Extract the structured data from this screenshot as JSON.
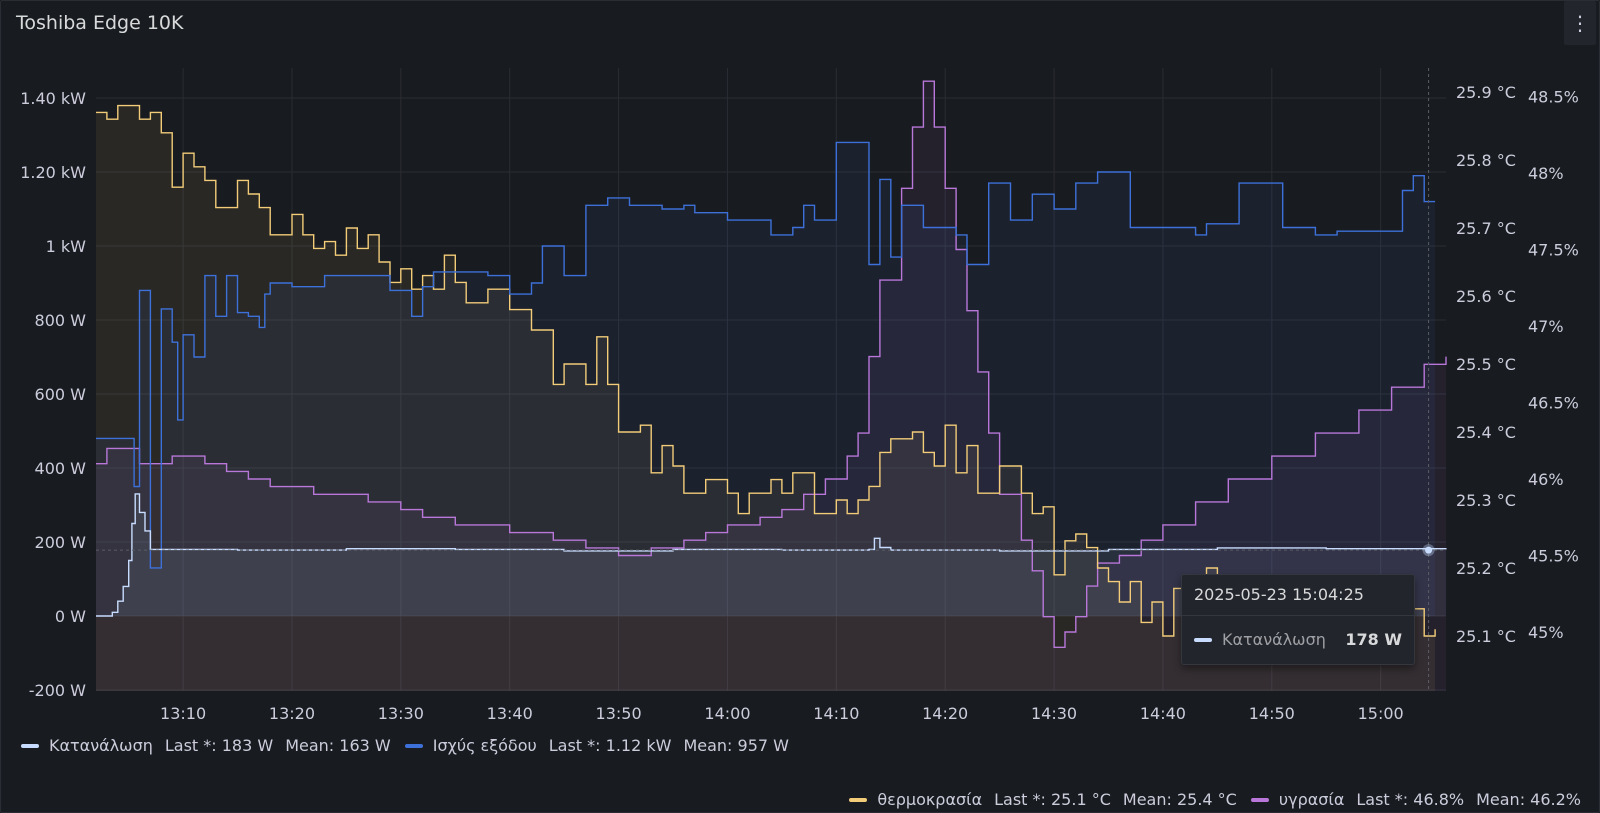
{
  "panel": {
    "title": "Toshiba Edge 10K",
    "menu_icon": "kebab-menu-icon"
  },
  "colors": {
    "consumption": "#c8dcff",
    "output": "#3d71d9",
    "temperature": "#f2cc79",
    "humidity": "#b877d9",
    "background": "#181b1f",
    "grid": "#2a2d33"
  },
  "legend": {
    "row1": [
      {
        "name": "Κατανάλωση",
        "last": "Last *: 183 W",
        "mean": "Mean: 163 W",
        "color": "#c8dcff"
      },
      {
        "name": "Ισχύς εξόδου",
        "last": "Last *: 1.12 kW",
        "mean": "Mean: 957 W",
        "color": "#3d71d9"
      }
    ],
    "row2": [
      {
        "name": "θερμοκρασία",
        "last": "Last *: 25.1 °C",
        "mean": "Mean: 25.4 °C",
        "color": "#f2cc79"
      },
      {
        "name": "υγρασία",
        "last": "Last *: 46.8%",
        "mean": "Mean: 46.2%",
        "color": "#b877d9"
      }
    ]
  },
  "tooltip": {
    "time": "2025-05-23 15:04:25",
    "series": "Κατανάλωση",
    "value": "178 W"
  },
  "chart_data": {
    "type": "line",
    "title": "Toshiba Edge 10K",
    "x_range": [
      "13:02",
      "15:06"
    ],
    "x_ticks": [
      "13:10",
      "13:20",
      "13:30",
      "13:40",
      "13:50",
      "14:00",
      "14:10",
      "14:20",
      "14:30",
      "14:40",
      "14:50",
      "15:00"
    ],
    "y_left": {
      "unit": "W",
      "range": [
        -200,
        1400
      ],
      "ticks": [
        "1.40 kW",
        "1.20 kW",
        "1 kW",
        "800 W",
        "600 W",
        "400 W",
        "200 W",
        "0 W",
        "-200 W"
      ],
      "tick_values": [
        1400,
        1200,
        1000,
        800,
        600,
        400,
        200,
        0,
        -200
      ]
    },
    "y_temp": {
      "unit": "°C",
      "range": [
        25.1,
        25.9
      ],
      "ticks": [
        "25.9 °C",
        "25.8 °C",
        "25.7 °C",
        "25.6 °C",
        "25.5 °C",
        "25.4 °C",
        "25.3 °C",
        "25.2 °C",
        "25.1 °C"
      ],
      "tick_values": [
        25.9,
        25.8,
        25.7,
        25.6,
        25.5,
        25.4,
        25.3,
        25.2,
        25.1
      ]
    },
    "y_hum": {
      "unit": "%",
      "range": [
        45,
        48.5
      ],
      "ticks": [
        "48.5%",
        "48%",
        "47.5%",
        "47%",
        "46.5%",
        "46%",
        "45.5%",
        "45%"
      ],
      "tick_values": [
        48.5,
        48,
        47.5,
        47,
        46.5,
        46,
        45.5,
        45
      ]
    },
    "series": [
      {
        "name": "Κατανάλωση",
        "axis": "left",
        "step": true,
        "points": [
          [
            "13:02",
            0
          ],
          [
            "13:03",
            0
          ],
          [
            "13:03.5",
            10
          ],
          [
            "13:04",
            40
          ],
          [
            "13:04.5",
            80
          ],
          [
            "13:05",
            150
          ],
          [
            "13:05.3",
            250
          ],
          [
            "13:05.6",
            330
          ],
          [
            "13:06",
            280
          ],
          [
            "13:06.5",
            230
          ],
          [
            "13:07",
            180
          ],
          [
            "13:15",
            178
          ],
          [
            "13:25",
            182
          ],
          [
            "13:35",
            180
          ],
          [
            "13:45",
            176
          ],
          [
            "13:55",
            180
          ],
          [
            "14:05",
            178
          ],
          [
            "14:13",
            180
          ],
          [
            "14:13.5",
            210
          ],
          [
            "14:14",
            185
          ],
          [
            "14:15",
            178
          ],
          [
            "14:25",
            176
          ],
          [
            "14:35",
            180
          ],
          [
            "14:45",
            184
          ],
          [
            "14:55",
            182
          ],
          [
            "15:06",
            183
          ]
        ]
      },
      {
        "name": "Ισχύς εξόδου",
        "axis": "left",
        "step": true,
        "points": [
          [
            "13:02",
            480
          ],
          [
            "13:05",
            480
          ],
          [
            "13:05.5",
            350
          ],
          [
            "13:06",
            880
          ],
          [
            "13:07",
            130
          ],
          [
            "13:08",
            830
          ],
          [
            "13:09",
            740
          ],
          [
            "13:09.5",
            530
          ],
          [
            "13:10",
            760
          ],
          [
            "13:11",
            700
          ],
          [
            "13:12",
            920
          ],
          [
            "13:13",
            810
          ],
          [
            "13:14",
            920
          ],
          [
            "13:15",
            820
          ],
          [
            "13:16",
            810
          ],
          [
            "13:17",
            780
          ],
          [
            "13:17.5",
            870
          ],
          [
            "13:18",
            900
          ],
          [
            "13:20",
            890
          ],
          [
            "13:23",
            920
          ],
          [
            "13:29",
            880
          ],
          [
            "13:31",
            810
          ],
          [
            "13:32",
            890
          ],
          [
            "13:33",
            930
          ],
          [
            "13:38",
            920
          ],
          [
            "13:40",
            870
          ],
          [
            "13:42",
            900
          ],
          [
            "13:43",
            1000
          ],
          [
            "13:45",
            920
          ],
          [
            "13:47",
            1110
          ],
          [
            "13:49",
            1130
          ],
          [
            "13:51",
            1110
          ],
          [
            "13:54",
            1100
          ],
          [
            "13:56",
            1110
          ],
          [
            "13:57",
            1090
          ],
          [
            "14:00",
            1070
          ],
          [
            "14:04",
            1030
          ],
          [
            "14:06",
            1050
          ],
          [
            "14:07",
            1110
          ],
          [
            "14:08",
            1070
          ],
          [
            "14:10",
            1280
          ],
          [
            "14:13",
            950
          ],
          [
            "14:14",
            1180
          ],
          [
            "14:15",
            970
          ],
          [
            "14:16",
            1110
          ],
          [
            "14:18",
            1050
          ],
          [
            "14:21",
            1030
          ],
          [
            "14:22",
            950
          ],
          [
            "14:24",
            1170
          ],
          [
            "14:26",
            1070
          ],
          [
            "14:28",
            1140
          ],
          [
            "14:30",
            1100
          ],
          [
            "14:32",
            1170
          ],
          [
            "14:34",
            1200
          ],
          [
            "14:37",
            1050
          ],
          [
            "14:40",
            1050
          ],
          [
            "14:43",
            1030
          ],
          [
            "14:44",
            1060
          ],
          [
            "14:47",
            1170
          ],
          [
            "14:51",
            1050
          ],
          [
            "14:54",
            1030
          ],
          [
            "14:56",
            1040
          ],
          [
            "15:02",
            1150
          ],
          [
            "15:03",
            1190
          ],
          [
            "15:04",
            1120
          ],
          [
            "15:05",
            1120
          ]
        ]
      },
      {
        "name": "θερμοκρασία",
        "axis": "temp",
        "step": true,
        "points": [
          [
            "13:02",
            25.87
          ],
          [
            "13:03",
            25.86
          ],
          [
            "13:04",
            25.88
          ],
          [
            "13:06",
            25.86
          ],
          [
            "13:07",
            25.87
          ],
          [
            "13:08",
            25.84
          ],
          [
            "13:09",
            25.76
          ],
          [
            "13:10",
            25.81
          ],
          [
            "13:11",
            25.79
          ],
          [
            "13:12",
            25.77
          ],
          [
            "13:13",
            25.73
          ],
          [
            "13:15",
            25.77
          ],
          [
            "13:16",
            25.75
          ],
          [
            "13:17",
            25.73
          ],
          [
            "13:18",
            25.69
          ],
          [
            "13:20",
            25.72
          ],
          [
            "13:21",
            25.69
          ],
          [
            "13:22",
            25.67
          ],
          [
            "13:23",
            25.68
          ],
          [
            "13:24",
            25.66
          ],
          [
            "13:25",
            25.7
          ],
          [
            "13:26",
            25.67
          ],
          [
            "13:27",
            25.69
          ],
          [
            "13:28",
            25.65
          ],
          [
            "13:29",
            25.62
          ],
          [
            "13:30",
            25.64
          ],
          [
            "13:31",
            25.61
          ],
          [
            "13:32",
            25.63
          ],
          [
            "13:33",
            25.61
          ],
          [
            "13:34",
            25.66
          ],
          [
            "13:35",
            25.62
          ],
          [
            "13:36",
            25.59
          ],
          [
            "13:38",
            25.61
          ],
          [
            "13:40",
            25.58
          ],
          [
            "13:42",
            25.55
          ],
          [
            "13:44",
            25.47
          ],
          [
            "13:45",
            25.5
          ],
          [
            "13:47",
            25.47
          ],
          [
            "13:48",
            25.54
          ],
          [
            "13:49",
            25.47
          ],
          [
            "13:50",
            25.4
          ],
          [
            "13:52",
            25.41
          ],
          [
            "13:53",
            25.34
          ],
          [
            "13:54",
            25.38
          ],
          [
            "13:55",
            25.35
          ],
          [
            "13:56",
            25.31
          ],
          [
            "13:58",
            25.33
          ],
          [
            "14:00",
            25.31
          ],
          [
            "14:01",
            25.28
          ],
          [
            "14:02",
            25.31
          ],
          [
            "14:04",
            25.33
          ],
          [
            "14:05",
            25.31
          ],
          [
            "14:06",
            25.34
          ],
          [
            "14:08",
            25.28
          ],
          [
            "14:10",
            25.3
          ],
          [
            "14:11",
            25.28
          ],
          [
            "14:12",
            25.3
          ],
          [
            "14:13",
            25.32
          ],
          [
            "14:14",
            25.37
          ],
          [
            "14:15",
            25.39
          ],
          [
            "14:17",
            25.4
          ],
          [
            "14:18",
            25.37
          ],
          [
            "14:19",
            25.35
          ],
          [
            "14:20",
            25.41
          ],
          [
            "14:21",
            25.34
          ],
          [
            "14:22",
            25.38
          ],
          [
            "14:23",
            25.31
          ],
          [
            "14:25",
            25.35
          ],
          [
            "14:27",
            25.31
          ],
          [
            "14:28",
            25.28
          ],
          [
            "14:29",
            25.29
          ],
          [
            "14:30",
            25.19
          ],
          [
            "14:31",
            25.24
          ],
          [
            "14:32",
            25.25
          ],
          [
            "14:33",
            25.23
          ],
          [
            "14:34",
            25.2
          ],
          [
            "14:35",
            25.18
          ],
          [
            "14:36",
            25.15
          ],
          [
            "14:37",
            25.18
          ],
          [
            "14:38",
            25.12
          ],
          [
            "14:39",
            25.15
          ],
          [
            "14:40",
            25.1
          ],
          [
            "14:41",
            25.17
          ],
          [
            "14:42",
            25.14
          ],
          [
            "14:43",
            25.18
          ],
          [
            "14:44",
            25.2
          ],
          [
            "14:45",
            25.15
          ],
          [
            "14:50",
            25.16
          ],
          [
            "14:55",
            25.15
          ],
          [
            "15:00",
            25.14
          ],
          [
            "15:04",
            25.1
          ],
          [
            "15:05",
            25.11
          ]
        ]
      },
      {
        "name": "υγρασία",
        "axis": "hum",
        "step": true,
        "points": [
          [
            "13:02",
            46.1
          ],
          [
            "13:03",
            46.2
          ],
          [
            "13:06",
            46.1
          ],
          [
            "13:09",
            46.15
          ],
          [
            "13:12",
            46.1
          ],
          [
            "13:14",
            46.05
          ],
          [
            "13:16",
            46.0
          ],
          [
            "13:18",
            45.95
          ],
          [
            "13:22",
            45.9
          ],
          [
            "13:27",
            45.85
          ],
          [
            "13:30",
            45.8
          ],
          [
            "13:32",
            45.75
          ],
          [
            "13:35",
            45.7
          ],
          [
            "13:40",
            45.65
          ],
          [
            "13:44",
            45.6
          ],
          [
            "13:47",
            45.55
          ],
          [
            "13:50",
            45.5
          ],
          [
            "13:53",
            45.55
          ],
          [
            "13:56",
            45.6
          ],
          [
            "13:58",
            45.65
          ],
          [
            "14:00",
            45.7
          ],
          [
            "14:03",
            45.75
          ],
          [
            "14:05",
            45.8
          ],
          [
            "14:07",
            45.9
          ],
          [
            "14:09",
            46.0
          ],
          [
            "14:11",
            46.15
          ],
          [
            "14:12",
            46.3
          ],
          [
            "14:13",
            46.8
          ],
          [
            "14:14",
            47.3
          ],
          [
            "14:16",
            47.9
          ],
          [
            "14:17",
            48.3
          ],
          [
            "14:18",
            48.6
          ],
          [
            "14:19",
            48.3
          ],
          [
            "14:20",
            47.9
          ],
          [
            "14:21",
            47.5
          ],
          [
            "14:22",
            47.1
          ],
          [
            "14:23",
            46.7
          ],
          [
            "14:24",
            46.3
          ],
          [
            "14:25",
            45.9
          ],
          [
            "14:27",
            45.6
          ],
          [
            "14:28",
            45.4
          ],
          [
            "14:29",
            45.1
          ],
          [
            "14:30",
            44.9
          ],
          [
            "14:31",
            45.0
          ],
          [
            "14:32",
            45.1
          ],
          [
            "14:33",
            45.3
          ],
          [
            "14:34",
            45.45
          ],
          [
            "14:36",
            45.5
          ],
          [
            "14:38",
            45.6
          ],
          [
            "14:40",
            45.7
          ],
          [
            "14:43",
            45.85
          ],
          [
            "14:46",
            46.0
          ],
          [
            "14:50",
            46.15
          ],
          [
            "14:54",
            46.3
          ],
          [
            "14:58",
            46.45
          ],
          [
            "15:01",
            46.6
          ],
          [
            "15:04",
            46.75
          ],
          [
            "15:06",
            46.8
          ]
        ]
      }
    ],
    "hover": {
      "time": "15:04:25",
      "value": 178
    }
  }
}
